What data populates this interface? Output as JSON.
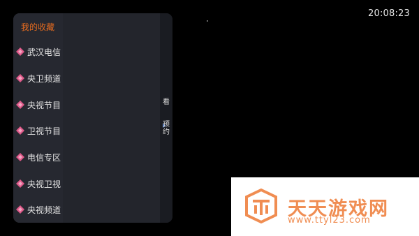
{
  "status_bar": {
    "time": "20:08:23"
  },
  "panel": {
    "favorites_title": "我的收藏",
    "categories": [
      {
        "label": "武汉电信",
        "icon": "diamond-icon"
      },
      {
        "label": "央卫频道",
        "icon": "diamond-icon"
      },
      {
        "label": "央视节目",
        "icon": "diamond-icon"
      },
      {
        "label": "卫视节目",
        "icon": "diamond-icon"
      },
      {
        "label": "电信专区",
        "icon": "diamond-icon"
      },
      {
        "label": "央视卫视",
        "icon": "diamond-icon"
      },
      {
        "label": "央视频道",
        "icon": "diamond-icon"
      }
    ],
    "side": {
      "watch_label": "看",
      "reserve_label_1": "预",
      "reserve_label_2": "约"
    }
  },
  "watermark": {
    "name": "天天游戏网",
    "url": "www.ttyl23.com",
    "color": "#f08d52"
  },
  "colors": {
    "accent": "#e36a1f",
    "icon_pink": "#e05a8a"
  }
}
